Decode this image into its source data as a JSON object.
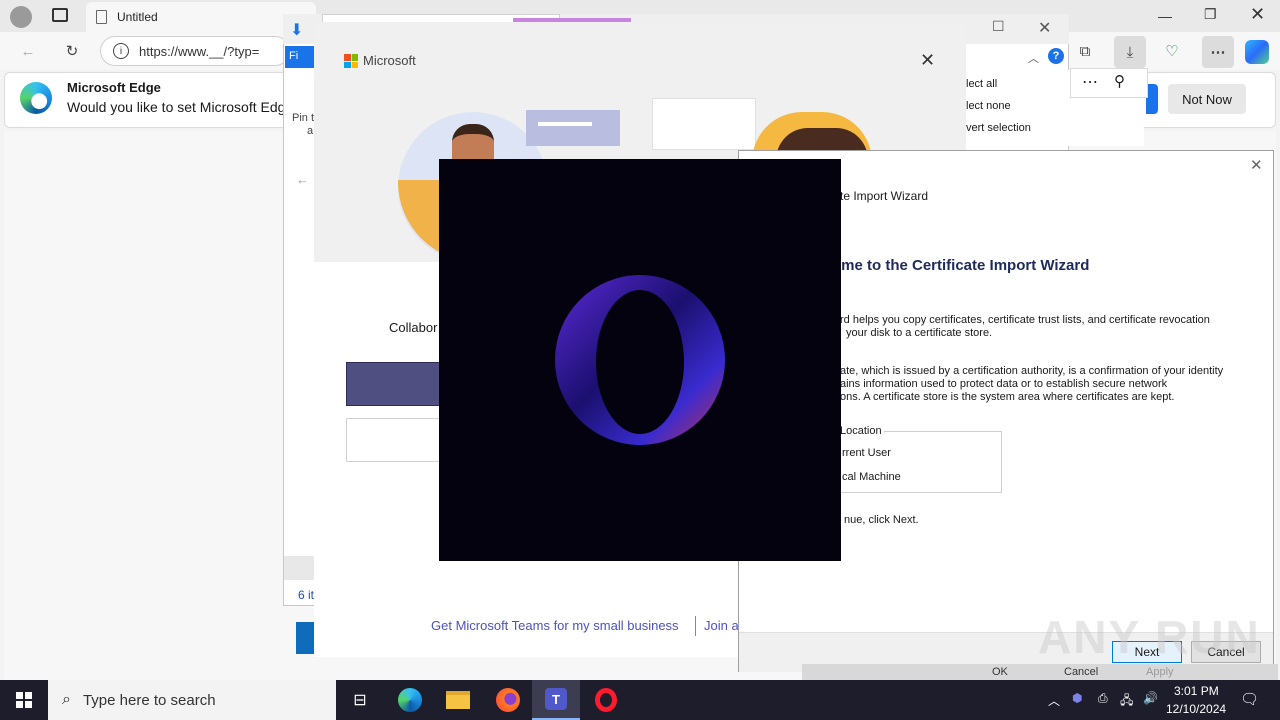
{
  "edge": {
    "tab_title": "Untitled",
    "address": "https://www.__/?typ=",
    "banner_title": "Microsoft Edge",
    "banner_text": "Would you like to set Microsoft Edge",
    "not_now": "Not Now"
  },
  "explorer": {
    "file_tab": "Fi",
    "pin_text1": "Pin t",
    "pin_text2": "a",
    "select_all": "lect all",
    "select_none": "lect none",
    "invert_selection": "vert selection",
    "item_count": "6 it"
  },
  "teams": {
    "brand": "Microsoft",
    "collab_text": "Collabor",
    "link_small_business": "Get Microsoft Teams for my small business",
    "link_join": "Join a"
  },
  "cert_wizard": {
    "title": "te Import Wizard",
    "heading": "ome to the Certificate Import Wizard",
    "para1_line1": "rd helps you copy certificates, certificate trust lists, and certificate revocation",
    "para1_line2": "your disk to a certificate store.",
    "para2_line1": "ate, which is issued by a certification authority, is a confirmation of your identity",
    "para2_line2": "ains information used to protect data or to establish secure network",
    "para2_line3": "ons. A certificate store is the system area where certificates are kept.",
    "store_location": "Location",
    "current_user": "rrent User",
    "local_machine": "cal Machine",
    "continue_text": "nue, click Next.",
    "next_label": "Next",
    "cancel_label": "Cancel",
    "behind_ok": "OK",
    "behind_cancel": "Cancel",
    "behind_apply": "Apply"
  },
  "taskbar": {
    "search_placeholder": "Type here to search",
    "time": "3:01 PM",
    "date": "12/10/2024"
  },
  "watermark": "ANY RUN",
  "colors": {
    "teams_purple": "#4f4f82",
    "edge_blue": "#1a73e8",
    "opera_bg": "#04020f",
    "taskbar": "#1d1d2b"
  }
}
